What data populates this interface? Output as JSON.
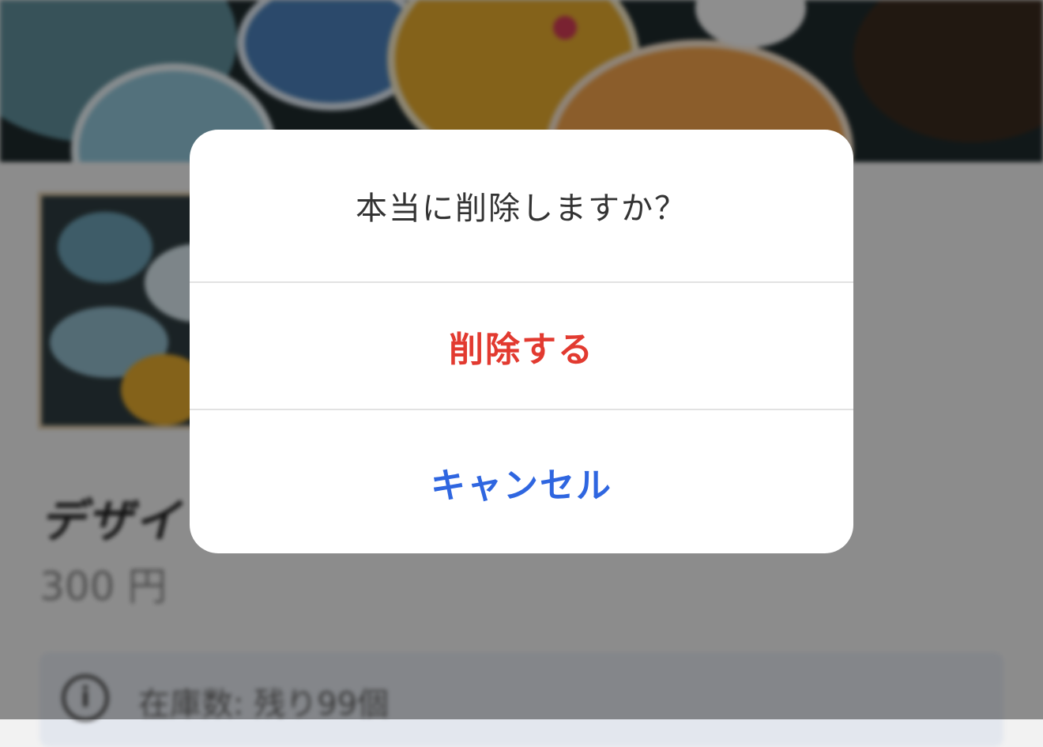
{
  "background": {
    "product_title": "デザイ",
    "product_price": "300 円",
    "stock_icon": "info-icon",
    "stock_text": "在庫数: 残り99個"
  },
  "dialog": {
    "message": "本当に削除しますか？",
    "delete_label": "削除する",
    "cancel_label": "キャンセル"
  },
  "colors": {
    "delete": "#e23a30",
    "cancel": "#2f66e0",
    "overlay": "rgba(0,0,0,0.42)"
  }
}
